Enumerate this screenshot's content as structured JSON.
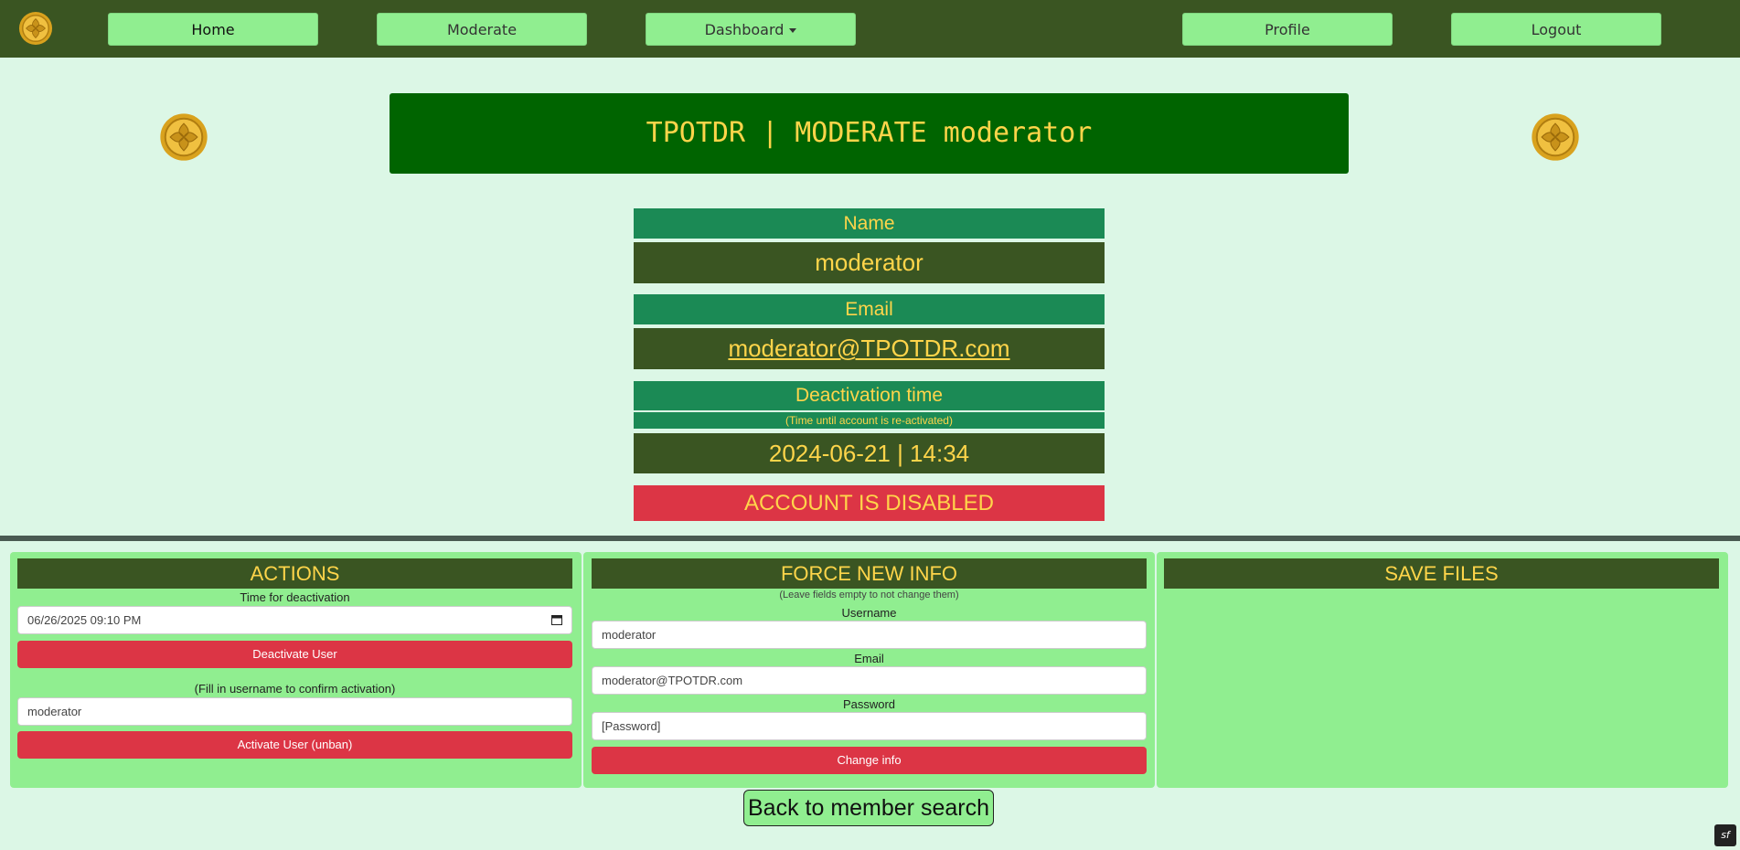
{
  "nav": {
    "home": "Home",
    "moderate": "Moderate",
    "dashboard": "Dashboard",
    "profile": "Profile",
    "logout": "Logout"
  },
  "header": {
    "title": "TPOTDR | MODERATE moderator"
  },
  "info": {
    "name_label": "Name",
    "name_value": "moderator",
    "email_label": "Email",
    "email_value": "moderator@TPOTDR.com",
    "deactivation_label": "Deactivation time",
    "deactivation_sub": "(Time until account is re-activated)",
    "deactivation_value": "2024-06-21 | 14:34",
    "status": "ACCOUNT IS DISABLED"
  },
  "actions": {
    "title": "ACTIONS",
    "time_label": "Time for deactivation",
    "time_value": "06/26/2025 09:10 PM",
    "deactivate_button": "Deactivate User",
    "confirm_label": "(Fill in username to confirm activation)",
    "confirm_value": "moderator",
    "activate_button": "Activate User (unban)"
  },
  "force_info": {
    "title": "FORCE NEW INFO",
    "hint": "(Leave fields empty to not change them)",
    "username_label": "Username",
    "username_placeholder": "moderator",
    "email_label": "Email",
    "email_placeholder": "moderator@TPOTDR.com",
    "password_label": "Password",
    "password_placeholder": "[Password]",
    "change_button": "Change info"
  },
  "save_files": {
    "title": "SAVE FILES"
  },
  "footer": {
    "back_button": "Back to member search",
    "badge": "sf"
  },
  "colors": {
    "nav_bg": "#3a5522",
    "button_green": "#90ee90",
    "title_bg": "#006400",
    "gold_text": "#ffd54a",
    "label_bg": "#1b8a55",
    "danger": "#dc3545",
    "page_bg": "#dcf7e6"
  }
}
